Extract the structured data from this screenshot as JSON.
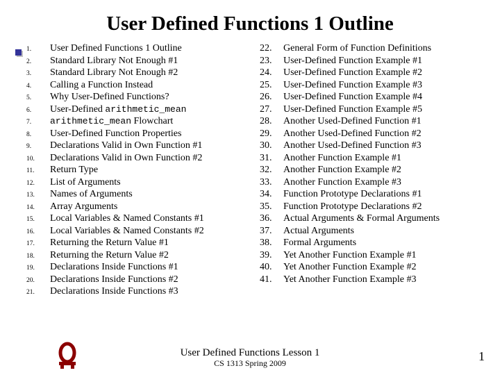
{
  "title": "User Defined Functions 1 Outline",
  "col1": [
    "User Defined Functions 1 Outline",
    "Standard Library Not Enough #1",
    "Standard Library Not Enough #2",
    "Calling a Function Instead",
    "Why User-Defined Functions?",
    "User-Defined ",
    "User-Defined Function Properties",
    "Declarations Valid in Own Function #1",
    "Declarations Valid in Own Function #2",
    "Return Type",
    "List of Arguments",
    "Names of Arguments",
    "Array Arguments",
    "Local Variables & Named Constants #1",
    "Local Variables & Named Constants #2",
    "Returning the Return Value #1",
    "Returning the Return Value #2",
    "Declarations Inside Functions #1",
    "Declarations Inside Functions #2",
    "Declarations Inside Functions #3"
  ],
  "col1_item6_mono": "arithmetic_mean",
  "col1_item7_mono": "arithmetic_mean",
  "col1_item7_suffix": " Flowchart",
  "col2_start": 22,
  "col2": [
    "General Form of Function Definitions",
    "User-Defined Function Example #1",
    "User-Defined Function Example #2",
    "User-Defined Function Example #3",
    "User-Defined Function Example #4",
    "User-Defined Function Example #5",
    "Another Used-Defined Function #1",
    "Another Used-Defined Function #2",
    "Another Used-Defined Function #3",
    "Another Function Example #1",
    "Another Function Example #2",
    "Another Function Example #3",
    "Function Prototype Declarations #1",
    "Function Prototype Declarations #2",
    "Actual Arguments & Formal Arguments",
    "Actual Arguments",
    "Formal Arguments",
    "Yet Another Function Example #1",
    "Yet Another Function Example #2",
    "Yet Another Function Example #3"
  ],
  "footer": {
    "line1": "User Defined Functions Lesson 1",
    "line2": "CS 1313 Spring 2009"
  },
  "page_number": "1",
  "logo_color": "#8b0000"
}
